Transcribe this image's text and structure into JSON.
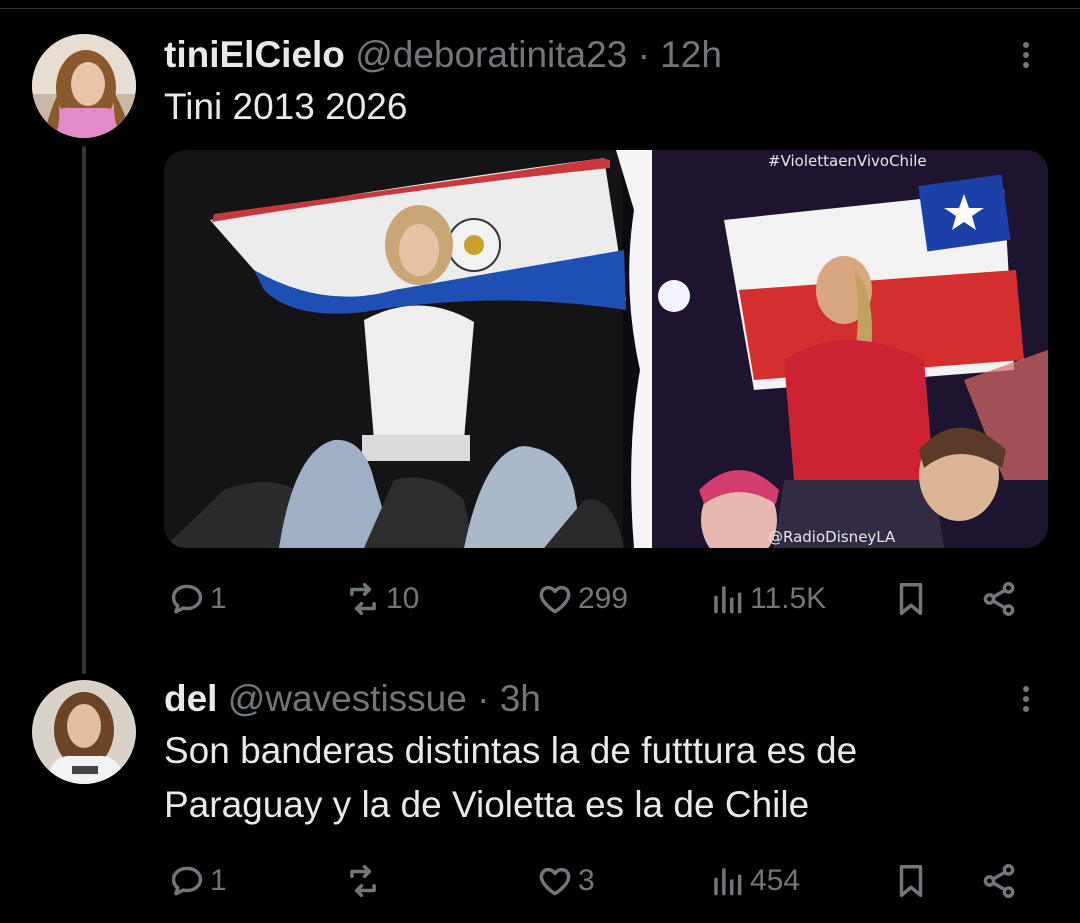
{
  "tweet1": {
    "display_name": "tiniElCielo",
    "handle": "@deboratinita23",
    "separator": "·",
    "time": "12h",
    "text": "Tini 2013 2026",
    "media": {
      "left_caption": "",
      "right_hashtag": "#ViolettaenVivoChile",
      "right_credit": "@RadioDisneyLA"
    },
    "stats": {
      "replies": "1",
      "reposts": "10",
      "likes": "299",
      "views": "11.5K"
    }
  },
  "tweet2": {
    "display_name": "del",
    "handle": "@wavestissue",
    "separator": "·",
    "time": "3h",
    "text_line1": "Son banderas distintas la de futttura es de",
    "text_line2": "Paraguay y la de Violetta es la de Chile",
    "stats": {
      "replies": "1",
      "reposts": "",
      "likes": "3",
      "views": "454"
    }
  },
  "icons": {
    "reply": "reply-icon",
    "repost": "repost-icon",
    "like": "heart-icon",
    "views": "views-icon",
    "bookmark": "bookmark-icon",
    "share": "share-icon",
    "more": "more-icon"
  },
  "colors": {
    "background": "#000000",
    "text": "#e7e9ea",
    "muted": "#71767b",
    "divider": "#2f3336"
  }
}
